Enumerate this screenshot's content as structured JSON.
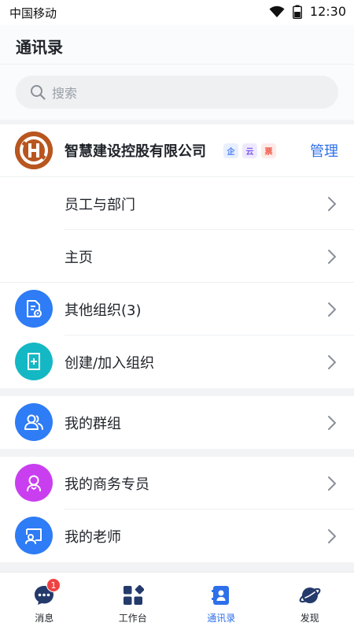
{
  "status_bar": {
    "carrier": "中国移动",
    "time": "12:30"
  },
  "header": {
    "title": "通讯录"
  },
  "search": {
    "placeholder": "搜索"
  },
  "organization": {
    "name": "智慧建设控股有限公司",
    "manage_label": "管理",
    "badges": [
      {
        "text": "企",
        "icon": "certified-enterprise-icon",
        "color": "#4a7ef0"
      },
      {
        "text": "云",
        "icon": "cloud-service-icon",
        "color": "#7b5cf0"
      },
      {
        "text": "票",
        "icon": "invoice-icon",
        "color": "#f05a4a"
      }
    ],
    "rows": [
      {
        "label": "员工与部门"
      },
      {
        "label": "主页"
      }
    ]
  },
  "org_actions": [
    {
      "label": "其他组织(3)",
      "icon": "organization-file-icon",
      "color": "#2e7cf6"
    },
    {
      "label": "创建/加入组织",
      "icon": "create-join-org-icon",
      "color": "#14b8c4"
    }
  ],
  "groups": {
    "label": "我的群组",
    "icon": "group-users-icon",
    "color": "#2e7cf6"
  },
  "contacts": [
    {
      "label": "我的商务专员",
      "icon": "business-specialist-icon",
      "color": "#c93ff0"
    },
    {
      "label": "我的老师",
      "icon": "teacher-board-icon",
      "color": "#2e7cf6"
    }
  ],
  "tabbar": {
    "active_color": "#2e6fea",
    "items": [
      {
        "label": "消息",
        "icon": "message-bubble-icon",
        "badge": "1"
      },
      {
        "label": "工作台",
        "icon": "workbench-grid-icon"
      },
      {
        "label": "通讯录",
        "icon": "contacts-book-icon",
        "active": true
      },
      {
        "label": "发现",
        "icon": "discover-planet-icon"
      }
    ]
  }
}
